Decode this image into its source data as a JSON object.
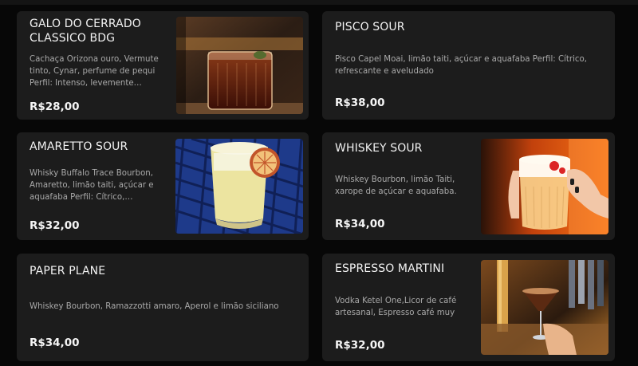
{
  "menu": {
    "items": [
      {
        "name": "GALO DO CERRADO CLASSICO BDG",
        "description": "Cachaça Orizona ouro, Vermute tinto, Cynar, perfume de pequi Perfil: Intenso, levemente…",
        "price": "R$28,00",
        "image": "dark-red-cocktail-glass-photo"
      },
      {
        "name": "PISCO SOUR",
        "description": "Pisco Capel Moai, limão taiti, açúcar e aquafaba Perfil: Cítrico, refrescante e aveludado",
        "price": "R$38,00"
      },
      {
        "name": "AMARETTO SOUR",
        "description": "Whisky Buffalo Trace Bourbon, Amaretto, limão taiti, açúcar e aquafaba Perfil: Cítrico,…",
        "price": "R$32,00",
        "image": "amaretto-sour-with-dried-orange-photo"
      },
      {
        "name": "WHISKEY SOUR",
        "description": "Whiskey Bourbon, limão Taiti, xarope de açúcar e aquafaba.",
        "price": "R$34,00",
        "image": "whiskey-sour-in-hand-photo"
      },
      {
        "name": "PAPER PLANE",
        "description": "Whiskey Bourbon, Ramazzotti amaro, Aperol e limão siciliano",
        "price": "R$34,00"
      },
      {
        "name": "ESPRESSO MARTINI",
        "description": "Vodka Ketel One,Licor de café artesanal, Espresso café muy",
        "price": "R$32,00",
        "image": "espresso-martini-at-bar-photo"
      }
    ]
  },
  "colors": {
    "background": "#070707",
    "card": "#1c1c1c",
    "title": "#f2f2f2",
    "description": "#a9a9a9",
    "price": "#f5f5f5"
  }
}
